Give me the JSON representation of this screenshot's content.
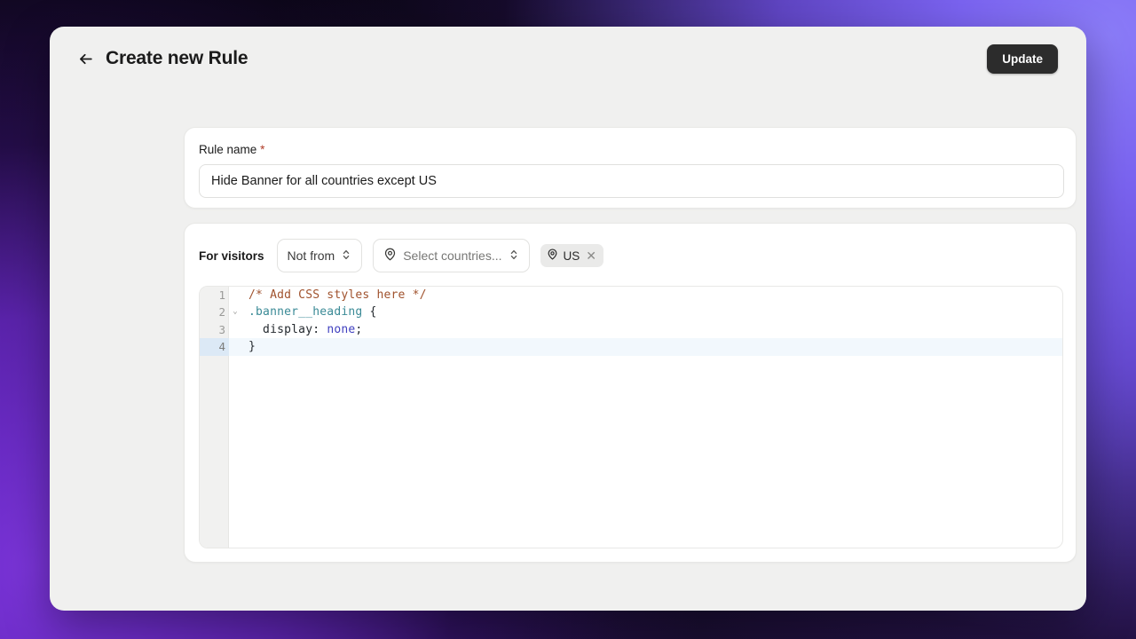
{
  "header": {
    "back_icon": "arrow-left-icon",
    "title": "Create new Rule",
    "update_label": "Update"
  },
  "rule_name_panel": {
    "label": "Rule name",
    "required_marker": "*",
    "input_value": "Hide Banner for all countries except US",
    "input_placeholder": "Rule name"
  },
  "visitors_panel": {
    "label": "For visitors",
    "condition_select": {
      "value": "Not from",
      "icon": "chevron-up-down-icon"
    },
    "country_select": {
      "placeholder": "Select countries...",
      "pin_icon": "map-pin-icon",
      "chevron_icon": "chevron-up-down-icon"
    },
    "selected_countries": [
      {
        "code": "US",
        "pin_icon": "map-pin-icon",
        "remove_icon": "close-icon"
      }
    ]
  },
  "editor": {
    "lines": [
      {
        "number": "1",
        "fold": "",
        "active": false,
        "tokens": [
          {
            "text": "/* Add CSS styles here */",
            "type": "comment"
          }
        ]
      },
      {
        "number": "2",
        "fold": "⌄",
        "active": false,
        "tokens": [
          {
            "text": ".banner__heading",
            "type": "selector"
          },
          {
            "text": " {",
            "type": "punct"
          }
        ]
      },
      {
        "number": "3",
        "fold": "",
        "active": false,
        "tokens": [
          {
            "text": "  display",
            "type": "prop"
          },
          {
            "text": ": ",
            "type": "punct"
          },
          {
            "text": "none",
            "type": "value"
          },
          {
            "text": ";",
            "type": "punct"
          }
        ]
      },
      {
        "number": "4",
        "fold": "",
        "active": true,
        "tokens": [
          {
            "text": "}",
            "type": "punct"
          }
        ]
      }
    ],
    "code_plain": "/* Add CSS styles here */\n.banner__heading {\n  display: none;\n}"
  },
  "colors": {
    "accent_dark": "#2c2c2c",
    "required_star": "#b03c28",
    "comment": "#a0522d",
    "selector": "#3a8a96",
    "value": "#3f3fbf",
    "active_line": "#f2f8fd",
    "gutter": "#f1f1f0",
    "window_bg": "#f0f0ef"
  }
}
